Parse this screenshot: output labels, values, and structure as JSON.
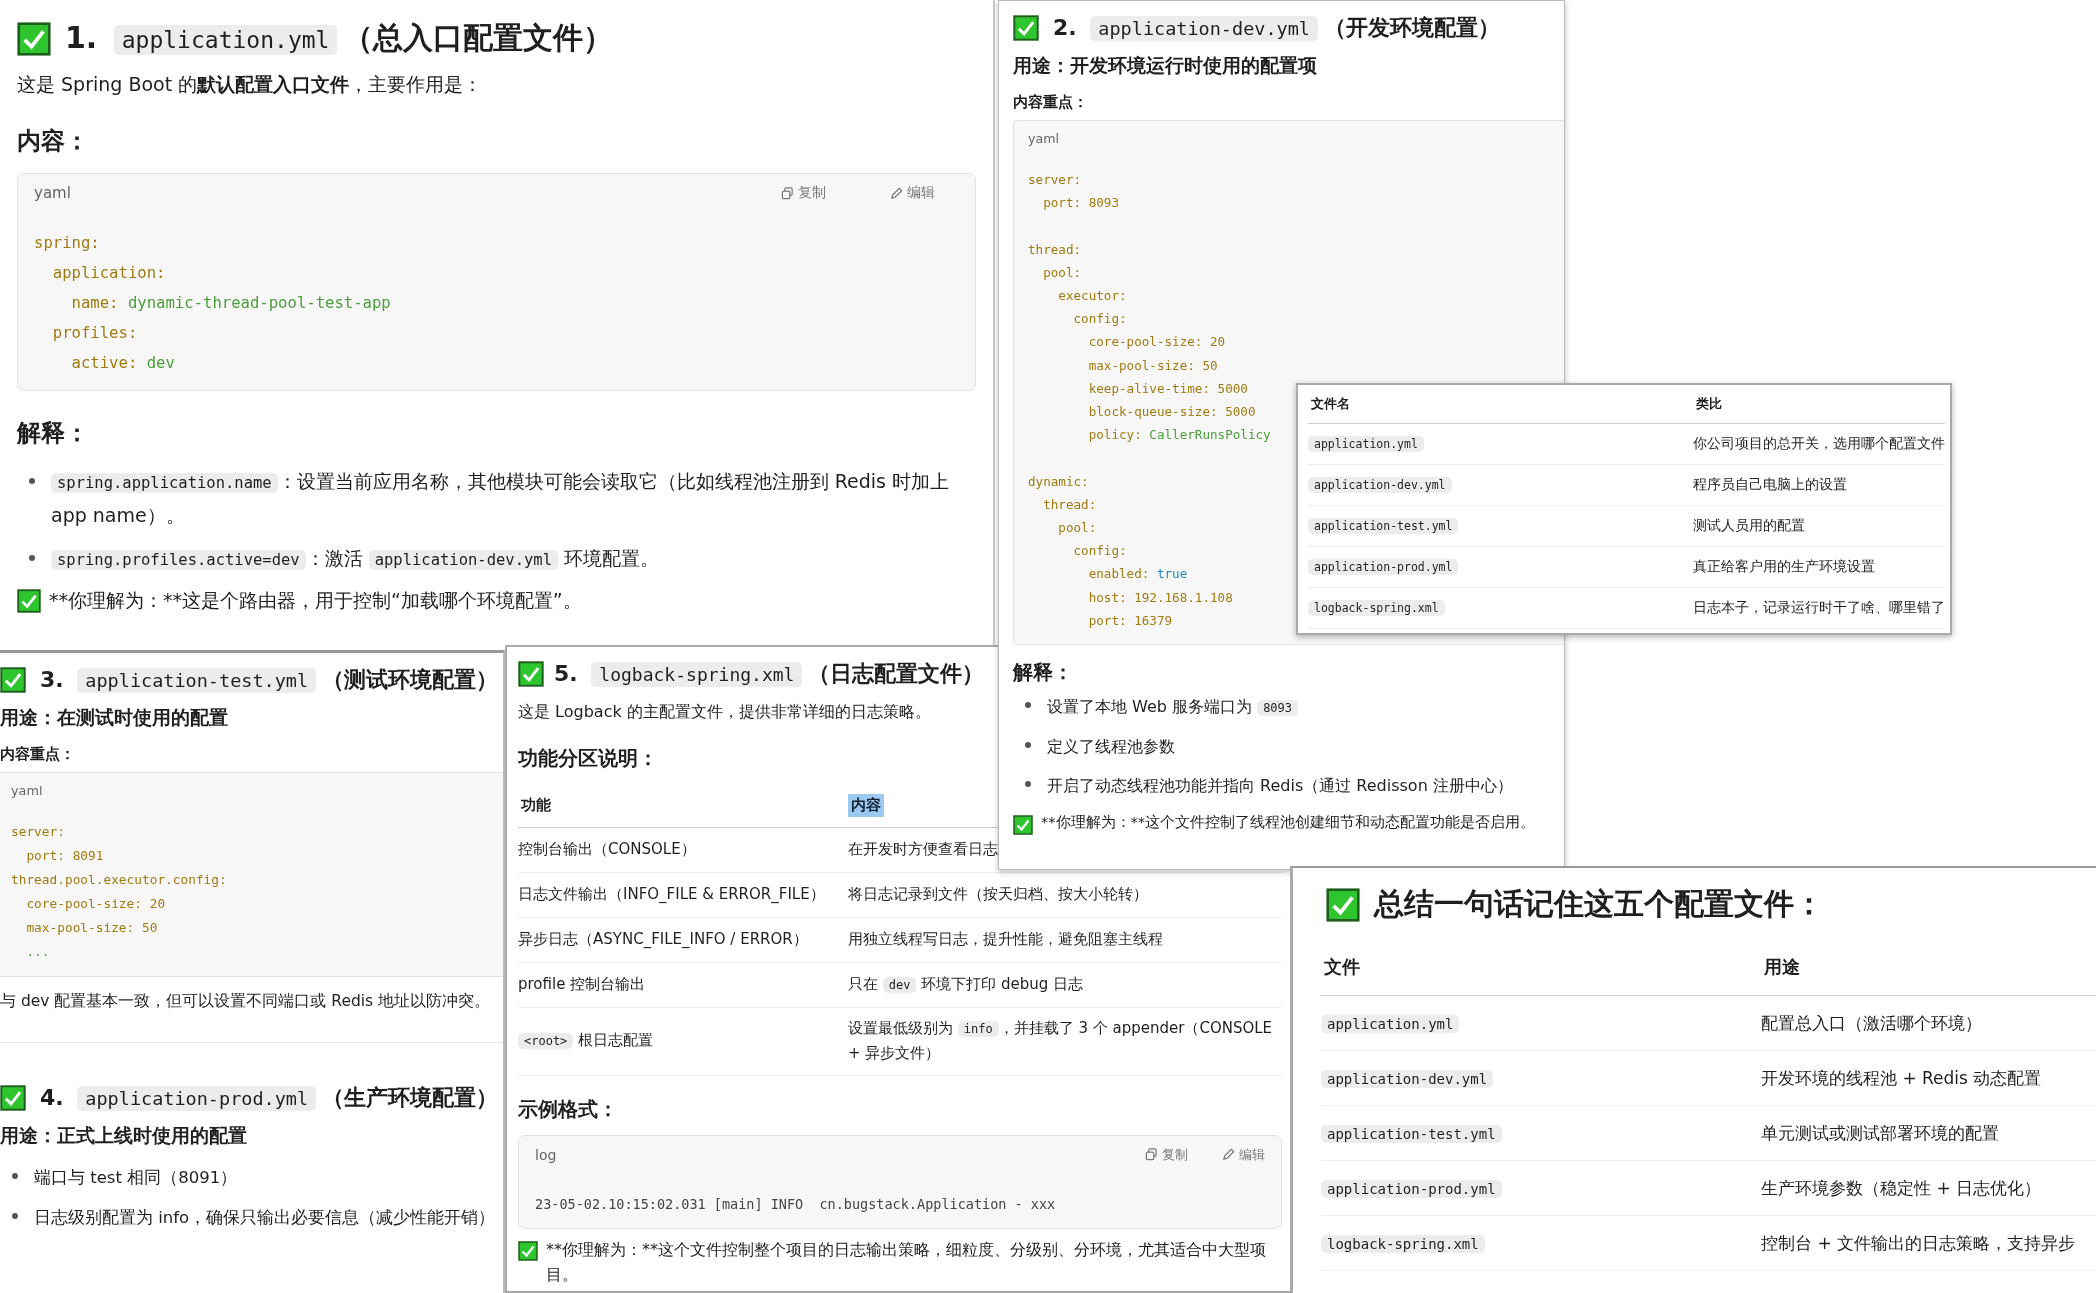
{
  "panels": [
    {
      "blocks": [
        {
          "kind": "heading",
          "number": "1.",
          "file": "application.yml",
          "title": "（总入口配置文件）"
        },
        {
          "kind": "paragraph",
          "text": "这是 Spring Boot 的**默认配置入口文件**，主要作用是："
        },
        {
          "kind": "subheading",
          "text": "内容："
        },
        {
          "kind": "code",
          "language": "yaml",
          "actions": [
            {
              "kind": "copy",
              "label": "复制"
            },
            {
              "kind": "edit",
              "label": "编辑"
            }
          ],
          "lines": [
            {
              "text": "spring:"
            },
            {
              "text": "  application:"
            },
            {
              "text": "    name: ",
              "value": "dynamic-thread-pool-test-app",
              "kind": "string"
            },
            {
              "text": "  profiles:"
            },
            {
              "text": "    active: ",
              "value": "dev",
              "kind": "string"
            }
          ]
        },
        {
          "kind": "subheading",
          "text": "解释："
        },
        {
          "kind": "bullets",
          "items": [
            {
              "parts": [
                {
                  "kind": "code",
                  "text": "spring.application.name"
                },
                {
                  "kind": "text",
                  "text": "：设置当前应用名称，其他模块可能会读取它（比如线程池注册到 Redis 时加上 app name）。"
                }
              ]
            },
            {
              "parts": [
                {
                  "kind": "code",
                  "text": "spring.profiles.active=dev"
                },
                {
                  "kind": "text",
                  "text": "：激活 "
                },
                {
                  "kind": "code",
                  "text": "application-dev.yml"
                },
                {
                  "kind": "text",
                  "text": " 环境配置。"
                }
              ]
            }
          ]
        },
        {
          "kind": "note",
          "text": "**你理解为：**这是个路由器，用于控制“加载哪个环境配置”。"
        }
      ]
    },
    {
      "blocks": [
        {
          "kind": "heading",
          "number": "2.",
          "file": "application-dev.yml",
          "title": "（开发环境配置）"
        },
        {
          "kind": "lead",
          "text": "用途：开发环境运行时使用的配置项"
        },
        {
          "kind": "label",
          "text": "内容重点："
        },
        {
          "kind": "code",
          "language": "yaml",
          "lines": [
            {
              "text": "server:"
            },
            {
              "text": "  port: 8093"
            },
            {
              "text": "thread:",
              "gap_before": true
            },
            {
              "text": "  pool:"
            },
            {
              "text": "    executor:"
            },
            {
              "text": "      config:"
            },
            {
              "text": "        core-pool-size: 20"
            },
            {
              "text": "        max-pool-size: 50"
            },
            {
              "text": "        keep-alive-time: 5000"
            },
            {
              "text": "        block-queue-size: 5000"
            },
            {
              "text": "        policy: ",
              "value": "CallerRunsPolicy",
              "kind": "string"
            },
            {
              "text": "dynamic:",
              "gap_before": true
            },
            {
              "text": "  thread:"
            },
            {
              "text": "    pool:"
            },
            {
              "text": "      config:"
            },
            {
              "text": "        enabled: ",
              "value": "true",
              "kind": "keyword"
            },
            {
              "text": "        host: 192.168.1.108"
            },
            {
              "text": "        port: 16379"
            }
          ]
        },
        {
          "kind": "subheading",
          "text": "解释："
        },
        {
          "kind": "bullets",
          "items": [
            {
              "parts": [
                {
                  "kind": "text",
                  "text": "设置了本地 Web 服务端口为 "
                },
                {
                  "kind": "code",
                  "text": "8093"
                }
              ]
            },
            {
              "parts": [
                {
                  "kind": "text",
                  "text": "定义了线程池参数"
                }
              ]
            },
            {
              "parts": [
                {
                  "kind": "text",
                  "text": "开启了动态线程池功能并指向 Redis（通过 Redisson 注册中心）"
                }
              ]
            }
          ]
        },
        {
          "kind": "note",
          "text": "**你理解为：**这个文件控制了线程池创建细节和动态配置功能是否启用。"
        }
      ]
    },
    {
      "blocks": [
        {
          "kind": "table",
          "columns": [
            {
              "text": "文件名"
            },
            {
              "text": "类比"
            }
          ],
          "rows": [
            [
              {
                "parts": [
                  {
                    "kind": "code",
                    "text": "application.yml"
                  }
                ]
              },
              "你公司项目的总开关，选用哪个配置文件"
            ],
            [
              {
                "parts": [
                  {
                    "kind": "code",
                    "text": "application-dev.yml"
                  }
                ]
              },
              "程序员自己电脑上的设置"
            ],
            [
              {
                "parts": [
                  {
                    "kind": "code",
                    "text": "application-test.yml"
                  }
                ]
              },
              "测试人员用的配置"
            ],
            [
              {
                "parts": [
                  {
                    "kind": "code",
                    "text": "application-prod.yml"
                  }
                ]
              },
              "真正给客户用的生产环境设置"
            ],
            [
              {
                "parts": [
                  {
                    "kind": "code",
                    "text": "logback-spring.xml"
                  }
                ]
              },
              "日志本子，记录运行时干了啥、哪里错了"
            ]
          ]
        }
      ]
    },
    {
      "blocks": [
        {
          "kind": "heading",
          "number": "3.",
          "file": "application-test.yml",
          "title": "（测试环境配置）"
        },
        {
          "kind": "lead",
          "text": "用途：在测试时使用的配置"
        },
        {
          "kind": "label",
          "text": "内容重点："
        },
        {
          "kind": "code",
          "language": "yaml",
          "lines": [
            {
              "text": "server:"
            },
            {
              "text": "  port: 8091"
            },
            {
              "text": "thread.pool.executor.config:"
            },
            {
              "text": "  core-pool-size: 20"
            },
            {
              "text": "  max-pool-size: 50"
            },
            {
              "value": "  ...",
              "kind": "string"
            }
          ]
        },
        {
          "kind": "paragraph",
          "text": "与 dev 配置基本一致，但可以设置不同端口或 Redis 地址以防冲突。"
        },
        {
          "kind": "rule"
        },
        {
          "kind": "heading",
          "number": "4.",
          "file": "application-prod.yml",
          "title": "（生产环境配置）"
        },
        {
          "kind": "lead",
          "text": "用途：正式上线时使用的配置"
        },
        {
          "kind": "bullets",
          "items": [
            {
              "parts": [
                {
                  "kind": "text",
                  "text": "端口与 test 相同（8091）"
                }
              ]
            },
            {
              "parts": [
                {
                  "kind": "text",
                  "text": "日志级别配置为 info，确保只输出必要信息（减少性能开销）"
                }
              ]
            }
          ]
        }
      ]
    },
    {
      "blocks": [
        {
          "kind": "heading",
          "number": "5.",
          "file": "logback-spring.xml",
          "title": "（日志配置文件）"
        },
        {
          "kind": "paragraph",
          "text": "这是 Logback 的主配置文件，提供非常详细的日志策略。"
        },
        {
          "kind": "subheading",
          "text": "功能分区说明："
        },
        {
          "kind": "table",
          "columns": [
            {
              "text": "功能"
            },
            {
              "text": "内容",
              "highlighted": true
            }
          ],
          "rows": [
            [
              "控制台输出（CONSOLE）",
              "在开发时方便查看日志"
            ],
            [
              "日志文件输出（INFO_FILE & ERROR_FILE）",
              "将日志记录到文件（按天归档、按大小轮转）"
            ],
            [
              "异步日志（ASYNC_FILE_INFO / ERROR）",
              "用独立线程写日志，提升性能，避免阻塞主线程"
            ],
            [
              "profile 控制台输出",
              {
                "parts": [
                  {
                    "kind": "text",
                    "text": "只在 "
                  },
                  {
                    "kind": "code",
                    "text": "dev"
                  },
                  {
                    "kind": "text",
                    "text": " 环境下打印 debug 日志"
                  }
                ]
              }
            ],
            [
              {
                "parts": [
                  {
                    "kind": "code",
                    "text": "<root>"
                  },
                  {
                    "kind": "text",
                    "text": " 根日志配置"
                  }
                ]
              },
              {
                "parts": [
                  {
                    "kind": "text",
                    "text": "设置最低级别为 "
                  },
                  {
                    "kind": "code",
                    "text": "info"
                  },
                  {
                    "kind": "text",
                    "text": "，并挂载了 3 个 appender（CONSOLE + 异步文件）"
                  }
                ]
              }
            ]
          ]
        },
        {
          "kind": "subheading",
          "text": "示例格式："
        },
        {
          "kind": "code",
          "language": "log",
          "actions": [
            {
              "kind": "copy",
              "label": "复制"
            },
            {
              "kind": "edit",
              "label": "编辑"
            }
          ],
          "lines": [
            {
              "value": "23-05-02.10:15:02.031 [main] INFO  cn.bugstack.Application - xxx",
              "kind": "plain"
            }
          ]
        },
        {
          "kind": "note",
          "text": "**你理解为：**这个文件控制整个项目的日志输出策略，细粒度、分级别、分环境，尤其适合中大型项目。"
        }
      ]
    },
    {
      "blocks": [
        {
          "kind": "heading",
          "title": "总结一句话记住这五个配置文件："
        },
        {
          "kind": "table",
          "columns": [
            {
              "text": "文件"
            },
            {
              "text": "用途"
            }
          ],
          "rows": [
            [
              {
                "parts": [
                  {
                    "kind": "code",
                    "text": "application.yml"
                  }
                ]
              },
              "配置总入口（激活哪个环境）"
            ],
            [
              {
                "parts": [
                  {
                    "kind": "code",
                    "text": "application-dev.yml"
                  }
                ]
              },
              "开发环境的线程池 + Redis 动态配置"
            ],
            [
              {
                "parts": [
                  {
                    "kind": "code",
                    "text": "application-test.yml"
                  }
                ]
              },
              "单元测试或测试部署环境的配置"
            ],
            [
              {
                "parts": [
                  {
                    "kind": "code",
                    "text": "application-prod.yml"
                  }
                ]
              },
              "生产环境参数（稳定性 + 日志优化）"
            ],
            [
              {
                "parts": [
                  {
                    "kind": "code",
                    "text": "logback-spring.xml"
                  }
                ]
              },
              "控制台 + 文件输出的日志策略，支持异步"
            ]
          ]
        }
      ]
    }
  ]
}
